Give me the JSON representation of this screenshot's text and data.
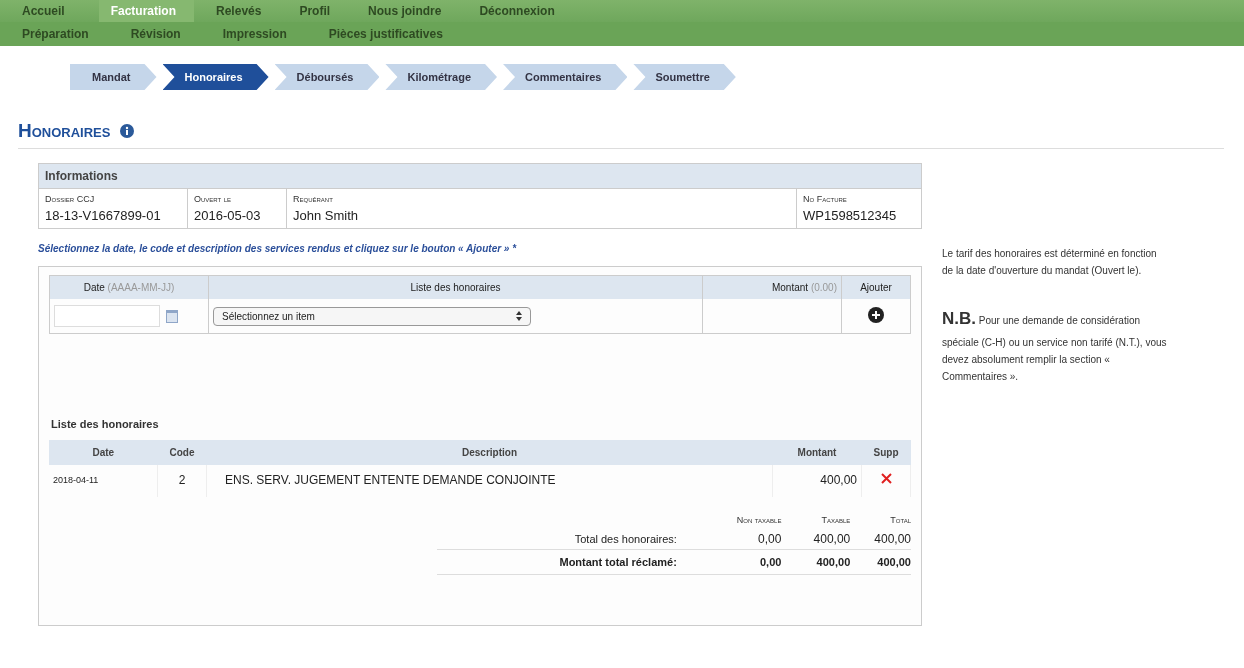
{
  "main_menu": [
    {
      "label": "Accueil",
      "selected": false
    },
    {
      "label": "Facturation",
      "selected": true
    },
    {
      "label": "Relevés",
      "selected": false
    },
    {
      "label": "Profil",
      "selected": false
    },
    {
      "label": "Nous joindre",
      "selected": false
    },
    {
      "label": "Déconnexion",
      "selected": false
    }
  ],
  "sub_menu": [
    {
      "label": "Préparation"
    },
    {
      "label": "Révision"
    },
    {
      "label": "Impression"
    },
    {
      "label": "Pièces justificatives"
    }
  ],
  "steps": [
    {
      "label": "Mandat",
      "selected": false
    },
    {
      "label": "Honoraires",
      "selected": true
    },
    {
      "label": "Déboursés",
      "selected": false
    },
    {
      "label": "Kilométrage",
      "selected": false
    },
    {
      "label": "Commentaires",
      "selected": false
    },
    {
      "label": "Soumettre",
      "selected": false
    }
  ],
  "page_title": "Honoraires",
  "informations": {
    "title": "Informations",
    "fields": [
      {
        "label": "Dossier CCJ",
        "value": "18-13-V1667899-01"
      },
      {
        "label": "Ouvert le",
        "value": "2016-05-03"
      },
      {
        "label": "Requérant",
        "value": "John Smith"
      },
      {
        "label": "No Facture",
        "value": "WP1598512345"
      }
    ]
  },
  "instruction": "Sélectionnez la date, le code et description des services rendus et cliquez sur le bouton « Ajouter » *",
  "entry_form": {
    "date_header": "Date",
    "date_hint": "(AAAA-MM-JJ)",
    "list_header": "Liste des honoraires",
    "amount_header": "Montant",
    "amount_hint": "(0.00)",
    "add_header": "Ajouter",
    "select_value": "Sélectionnez un item"
  },
  "fee_list": {
    "title": "Liste des honoraires",
    "columns": [
      "Date",
      "Code",
      "Description",
      "Montant",
      "Supp"
    ],
    "rows": [
      {
        "date": "2018-04-11",
        "code": "2",
        "description": "ENS. SERV. JUGEMENT ENTENTE DEMANDE CONJOINTE",
        "amount": "400,00"
      }
    ]
  },
  "totals": {
    "columns": [
      "Non taxable",
      "Taxable",
      "Total"
    ],
    "rows": [
      {
        "label": "Total des honoraires:",
        "values": [
          "0,00",
          "400,00",
          "400,00"
        ],
        "bold": false
      },
      {
        "label": "Montant total réclamé:",
        "values": [
          "0,00",
          "400,00",
          "400,00"
        ],
        "bold": true
      }
    ]
  },
  "side_note": "Le tarif des honoraires est déterminé en fonction de la date d'ouverture du mandat (Ouvert le).",
  "nb_note": {
    "mark": "N.B.",
    "text": "Pour une demande de considération spéciale (C-H) ou un service non tarifé (N.T.), vous devez absolument remplir la section « Commentaires »."
  }
}
